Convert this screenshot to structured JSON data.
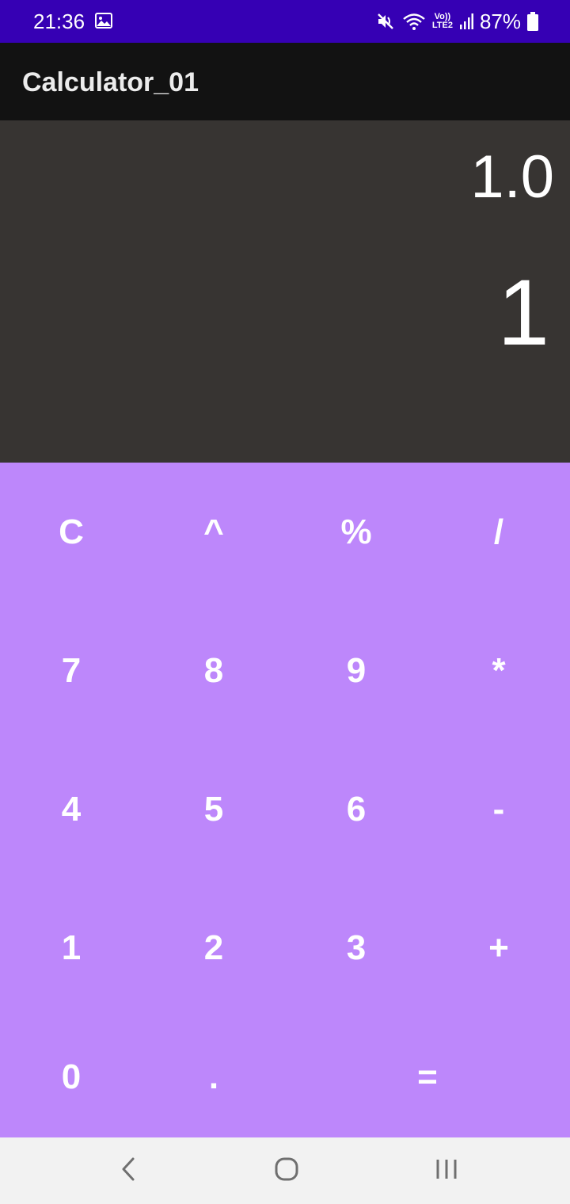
{
  "status_bar": {
    "time": "21:36",
    "battery": "87%",
    "lte_top": "Vo))",
    "lte_bottom": "LTE2",
    "icons": [
      "gallery-icon",
      "mute-icon",
      "wifi-icon",
      "volte-icon",
      "signal-icon",
      "battery-icon"
    ]
  },
  "app_bar": {
    "title": "Calculator_01"
  },
  "display": {
    "expression": "1.0",
    "result": "1"
  },
  "keypad": {
    "rows": [
      [
        "C",
        "^",
        "%",
        "/"
      ],
      [
        "7",
        "8",
        "9",
        "*"
      ],
      [
        "4",
        "5",
        "6",
        "-"
      ],
      [
        "1",
        "2",
        "3",
        "+"
      ],
      [
        "0",
        ".",
        "="
      ]
    ]
  },
  "nav_bar": {
    "icons": [
      "back-icon",
      "home-icon",
      "recents-icon"
    ]
  },
  "colors": {
    "status_bar": "#3600B4",
    "app_bar": "#121212",
    "display": "#373432",
    "keypad": "#BD87FB",
    "nav_bar": "#F2F2F2"
  }
}
